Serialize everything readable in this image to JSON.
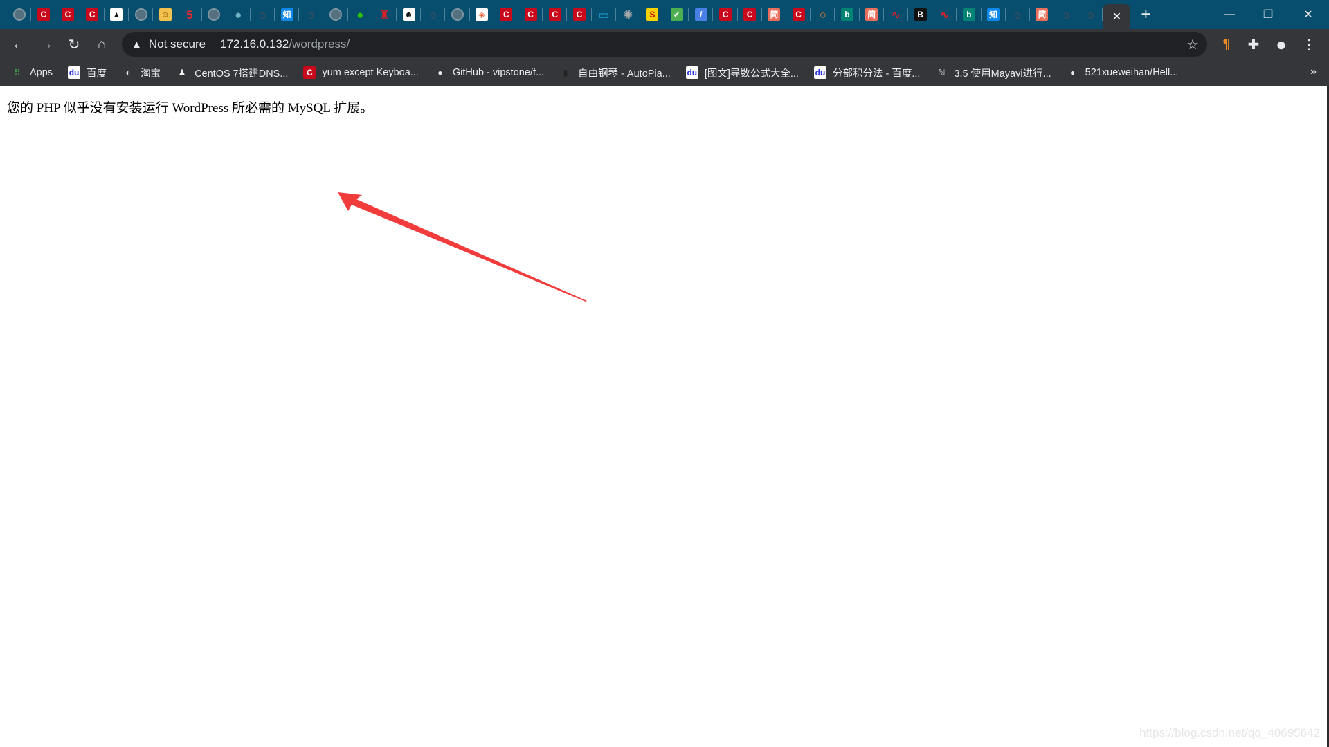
{
  "tabs": [
    {
      "icon": "globe-icon",
      "glyph": "",
      "bg": "#55717f",
      "type": "globe"
    },
    {
      "icon": "csdn-icon",
      "glyph": "C",
      "bg": "#c9081b"
    },
    {
      "icon": "csdn-icon",
      "glyph": "C",
      "bg": "#c9081b"
    },
    {
      "icon": "csdn-icon",
      "glyph": "C",
      "bg": "#c9081b"
    },
    {
      "icon": "cat-icon",
      "glyph": "▲",
      "bg": "#ffffff",
      "fg": "#111"
    },
    {
      "icon": "globe-icon",
      "glyph": "",
      "bg": "#55717f",
      "type": "globe"
    },
    {
      "icon": "cartoon-icon",
      "glyph": "☺",
      "bg": "#f2c14e",
      "fg": "#8a4b00"
    },
    {
      "icon": "five-icon",
      "glyph": "5",
      "bg": "transparent",
      "fg": "#e8262c"
    },
    {
      "icon": "globe-icon",
      "glyph": "",
      "bg": "#55717f",
      "type": "globe"
    },
    {
      "icon": "saturn-icon",
      "glyph": "●",
      "bg": "transparent",
      "fg": "#6fb2c2"
    },
    {
      "icon": "loading-icon",
      "glyph": "ↄ",
      "bg": "transparent",
      "fg": "#2f4f5f"
    },
    {
      "icon": "zhihu-icon",
      "glyph": "知",
      "bg": "#0f88eb"
    },
    {
      "icon": "loading-icon",
      "glyph": "ↄ",
      "bg": "transparent",
      "fg": "#2f4f5f"
    },
    {
      "icon": "globe-icon",
      "glyph": "",
      "bg": "#55717f",
      "type": "globe"
    },
    {
      "icon": "wechat-icon",
      "glyph": "●",
      "bg": "transparent",
      "fg": "#2dc100"
    },
    {
      "icon": "badge-icon",
      "glyph": "♜",
      "bg": "transparent",
      "fg": "#d8202a"
    },
    {
      "icon": "panda-icon",
      "glyph": "☻",
      "bg": "#ffffff",
      "fg": "#111"
    },
    {
      "icon": "loading-icon",
      "glyph": "ↄ",
      "bg": "transparent",
      "fg": "#2f4f5f"
    },
    {
      "icon": "globe-icon",
      "glyph": "",
      "bg": "#55717f",
      "type": "globe"
    },
    {
      "icon": "shield-icon",
      "glyph": "◈",
      "bg": "#ffffff",
      "fg": "#e8572c"
    },
    {
      "icon": "csdn-icon",
      "glyph": "C",
      "bg": "#c9081b"
    },
    {
      "icon": "csdn-icon",
      "glyph": "C",
      "bg": "#c9081b"
    },
    {
      "icon": "csdn-icon",
      "glyph": "C",
      "bg": "#c9081b"
    },
    {
      "icon": "csdn-icon",
      "glyph": "C",
      "bg": "#c9081b"
    },
    {
      "icon": "bilibili-icon",
      "glyph": "▭",
      "bg": "transparent",
      "fg": "#23ade5"
    },
    {
      "icon": "gear-icon",
      "glyph": "✺",
      "bg": "transparent",
      "fg": "#aaaaaa"
    },
    {
      "icon": "s-icon",
      "glyph": "S",
      "bg": "#f7d100",
      "fg": "#c00"
    },
    {
      "icon": "check-icon",
      "glyph": "✔",
      "bg": "#4caf50"
    },
    {
      "icon": "feather-icon",
      "glyph": "/",
      "bg": "#4a7fe8"
    },
    {
      "icon": "csdn-icon",
      "glyph": "C",
      "bg": "#c9081b"
    },
    {
      "icon": "csdn-icon",
      "glyph": "C",
      "bg": "#c9081b"
    },
    {
      "icon": "jianshu-icon",
      "glyph": "简",
      "bg": "#ea6f5a"
    },
    {
      "icon": "csdn-icon",
      "glyph": "C",
      "bg": "#c9081b"
    },
    {
      "icon": "orange-icon",
      "glyph": "○",
      "bg": "transparent",
      "fg": "#f07a2b"
    },
    {
      "icon": "bing-icon",
      "glyph": "b",
      "bg": "#008373"
    },
    {
      "icon": "jianshu-icon",
      "glyph": "简",
      "bg": "#ea6f5a"
    },
    {
      "icon": "wave-icon",
      "glyph": "∿",
      "bg": "transparent",
      "fg": "#d8202a"
    },
    {
      "icon": "b-icon",
      "glyph": "B",
      "bg": "#111111"
    },
    {
      "icon": "wave-icon",
      "glyph": "∿",
      "bg": "transparent",
      "fg": "#d8202a"
    },
    {
      "icon": "bing-icon",
      "glyph": "b",
      "bg": "#008373"
    },
    {
      "icon": "zhihu-icon",
      "glyph": "知",
      "bg": "#0f88eb"
    },
    {
      "icon": "loading-icon",
      "glyph": "ↄ",
      "bg": "transparent",
      "fg": "#2f4f5f"
    },
    {
      "icon": "jianshu-icon",
      "glyph": "简",
      "bg": "#ea6f5a"
    },
    {
      "icon": "loading-icon",
      "glyph": "ↄ",
      "bg": "transparent",
      "fg": "#2f4f5f"
    },
    {
      "icon": "loading-icon",
      "glyph": "ↄ",
      "bg": "transparent",
      "fg": "#2f4f5f"
    }
  ],
  "active_tab": {
    "close_glyph": "✕"
  },
  "new_tab_glyph": "+",
  "window": {
    "minimize": "—",
    "restore": "❐",
    "close": "✕"
  },
  "toolbar": {
    "back": "←",
    "forward": "→",
    "reload": "↻",
    "home": "⌂",
    "warning": "▲",
    "not_secure": "Not secure",
    "url_host": "172.16.0.132",
    "url_path": "/wordpress/",
    "star": "☆",
    "extension": "¶",
    "puzzle": "✚",
    "profile": "●",
    "menu": "⋮"
  },
  "bookmarks": [
    {
      "label": "Apps",
      "icon": "apps-grid-icon",
      "glyph": "⁞⁞",
      "bg": "transparent",
      "fg": "#4caf50"
    },
    {
      "label": "百度",
      "icon": "baidu-icon",
      "glyph": "du",
      "bg": "#ffffff",
      "fg": "#2932e1"
    },
    {
      "label": "淘宝",
      "icon": "globe-icon",
      "glyph": "◐",
      "bg": "transparent",
      "fg": "#e8eaed"
    },
    {
      "label": "CentOS 7搭建DNS...",
      "icon": "linux-penguin-icon",
      "glyph": "♟",
      "bg": "transparent",
      "fg": "#f5f5f5"
    },
    {
      "label": "yum except Keyboa...",
      "icon": "csdn-icon",
      "glyph": "C",
      "bg": "#c9081b",
      "fg": "#fff"
    },
    {
      "label": "GitHub - vipstone/f...",
      "icon": "github-icon",
      "glyph": "●",
      "bg": "transparent",
      "fg": "#e8eaed"
    },
    {
      "label": "自由钢琴 - AutoPia...",
      "icon": "piano-icon",
      "glyph": "▮",
      "bg": "transparent",
      "fg": "#222"
    },
    {
      "label": "[图文]导数公式大全...",
      "icon": "baidu-icon",
      "glyph": "du",
      "bg": "#ffffff",
      "fg": "#2932e1"
    },
    {
      "label": "分部积分法 - 百度...",
      "icon": "baidu-icon",
      "glyph": "du",
      "bg": "#ffffff",
      "fg": "#2932e1"
    },
    {
      "label": "3.5 使用Mayavi进行...",
      "icon": "book-icon",
      "glyph": "ℕ",
      "bg": "transparent",
      "fg": "#cccccc"
    },
    {
      "label": "521xueweihan/Hell...",
      "icon": "github-icon",
      "glyph": "●",
      "bg": "transparent",
      "fg": "#e8eaed"
    }
  ],
  "bookmarks_more": "»",
  "page": {
    "message": "您的 PHP 似乎没有安装运行 WordPress 所必需的 MySQL 扩展。"
  },
  "annotation": {
    "arrow_color": "#f23c3c"
  },
  "watermark": "https://blog.csdn.net/qq_40695642"
}
